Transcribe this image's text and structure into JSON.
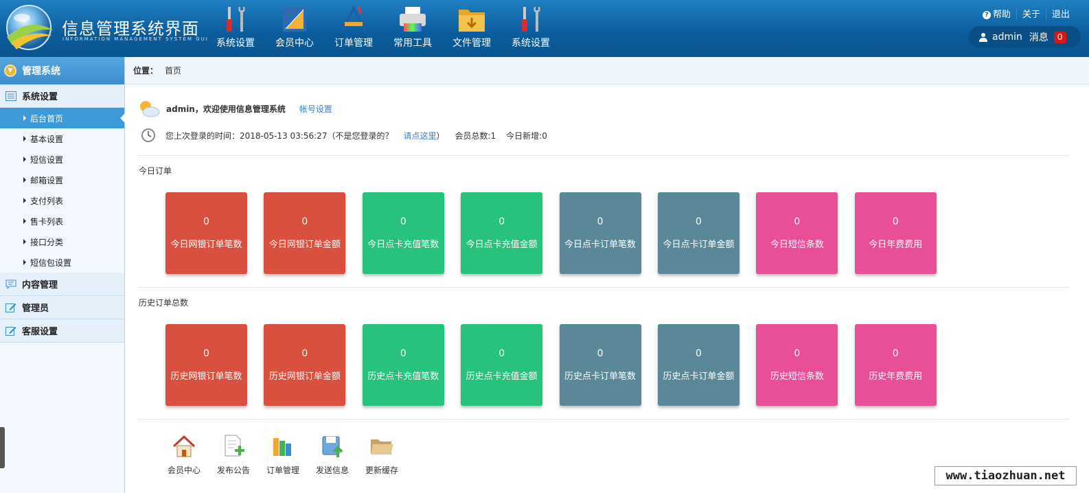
{
  "header": {
    "title": "信息管理系统界面",
    "subtitle": "INFORMATION MANAGEMENT SYSTEM GUI",
    "nav": [
      {
        "label": "系统设置",
        "icon": "tools-icon"
      },
      {
        "label": "会员中心",
        "icon": "ruler-icon"
      },
      {
        "label": "订单管理",
        "icon": "drafting-tools-icon"
      },
      {
        "label": "常用工具",
        "icon": "printer-icon"
      },
      {
        "label": "文件管理",
        "icon": "folder-icon"
      },
      {
        "label": "系统设置",
        "icon": "tools-icon"
      }
    ],
    "links": {
      "help": "帮助",
      "about": "关于",
      "logout": "退出"
    },
    "user": {
      "name": "admin",
      "messages_label": "消息",
      "messages_count": "0"
    }
  },
  "sidebar": {
    "header": "管理系统",
    "groups": [
      {
        "label": "系统设置",
        "icon": "list-icon"
      },
      {
        "label": "内容管理",
        "icon": "chat-icon"
      },
      {
        "label": "管理员",
        "icon": "edit-icon"
      },
      {
        "label": "客服设置",
        "icon": "edit-icon"
      }
    ],
    "items": [
      "后台首页",
      "基本设置",
      "短信设置",
      "邮箱设置",
      "支付列表",
      "售卡列表",
      "接口分类",
      "短信包设置"
    ]
  },
  "breadcrumb": {
    "label": "位置：",
    "current": "首页"
  },
  "welcome": {
    "text": "admin，欢迎使用信息管理系统",
    "account_link": "帐号设置",
    "last_login_prefix": "您上次登录的时间：2018-05-13 03:56:27（不是您登录的？",
    "click_here": "请点这里",
    "last_login_suffix": "）",
    "members_total": "会员总数:1",
    "today_new": "今日新增:0"
  },
  "today": {
    "title": "今日订单",
    "cards": [
      {
        "value": "0",
        "label": "今日网银订单笔数",
        "color": "#d9503f"
      },
      {
        "value": "0",
        "label": "今日网银订单金额",
        "color": "#d9503f"
      },
      {
        "value": "0",
        "label": "今日点卡充值笔数",
        "color": "#27c27c"
      },
      {
        "value": "0",
        "label": "今日点卡充值金额",
        "color": "#27c27c"
      },
      {
        "value": "0",
        "label": "今日点卡订单笔数",
        "color": "#5a8898"
      },
      {
        "value": "0",
        "label": "今日点卡订单金额",
        "color": "#5a8898"
      },
      {
        "value": "0",
        "label": "今日短信条数",
        "color": "#e94f97"
      },
      {
        "value": "0",
        "label": "今日年费费用",
        "color": "#e94f97"
      }
    ]
  },
  "history": {
    "title": "历史订单总数",
    "cards": [
      {
        "value": "0",
        "label": "历史网银订单笔数",
        "color": "#d9503f"
      },
      {
        "value": "0",
        "label": "历史网银订单金额",
        "color": "#d9503f"
      },
      {
        "value": "0",
        "label": "历史点卡充值笔数",
        "color": "#27c27c"
      },
      {
        "value": "0",
        "label": "历史点卡充值金额",
        "color": "#27c27c"
      },
      {
        "value": "0",
        "label": "历史点卡订单笔数",
        "color": "#5a8898"
      },
      {
        "value": "0",
        "label": "历史点卡订单金额",
        "color": "#5a8898"
      },
      {
        "value": "0",
        "label": "历史短信条数",
        "color": "#e94f97"
      },
      {
        "value": "0",
        "label": "历史年费费用",
        "color": "#e94f97"
      }
    ]
  },
  "quick_links": [
    {
      "label": "会员中心",
      "icon": "home-icon"
    },
    {
      "label": "发布公告",
      "icon": "new-document-icon"
    },
    {
      "label": "订单管理",
      "icon": "books-icon"
    },
    {
      "label": "发送信息",
      "icon": "save-upload-icon"
    },
    {
      "label": "更新缓存",
      "icon": "open-folder-icon"
    }
  ],
  "watermark": "www.tiaozhuan.net"
}
